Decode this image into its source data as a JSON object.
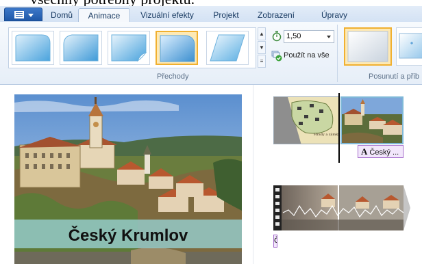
{
  "partial_title": "všechny potřebný projektu.",
  "tabs": [
    {
      "label": "Domů",
      "active": false
    },
    {
      "label": "Animace",
      "active": true
    },
    {
      "label": "Vizuální efekty",
      "active": false
    },
    {
      "label": "Projekt",
      "active": false
    },
    {
      "label": "Zobrazení",
      "active": false
    },
    {
      "label": "Úpravy",
      "active": false
    }
  ],
  "ribbon": {
    "transitions_label": "Přechody",
    "duration_value": "1,50",
    "apply_all_label": "Použít na vše",
    "pan_zoom_label": "Posunutí a přib"
  },
  "preview": {
    "caption": "Český Krumlov"
  },
  "storyboard": {
    "caption_tag": "Český ...",
    "caption_tag_icon": "A",
    "caption_tag2": "Č"
  },
  "colors": {
    "accent": "#f0b030",
    "app_menu": "#1f58a8",
    "caption_band": "#96cdcd",
    "caption_tag_bg": "#f2e6fb"
  }
}
